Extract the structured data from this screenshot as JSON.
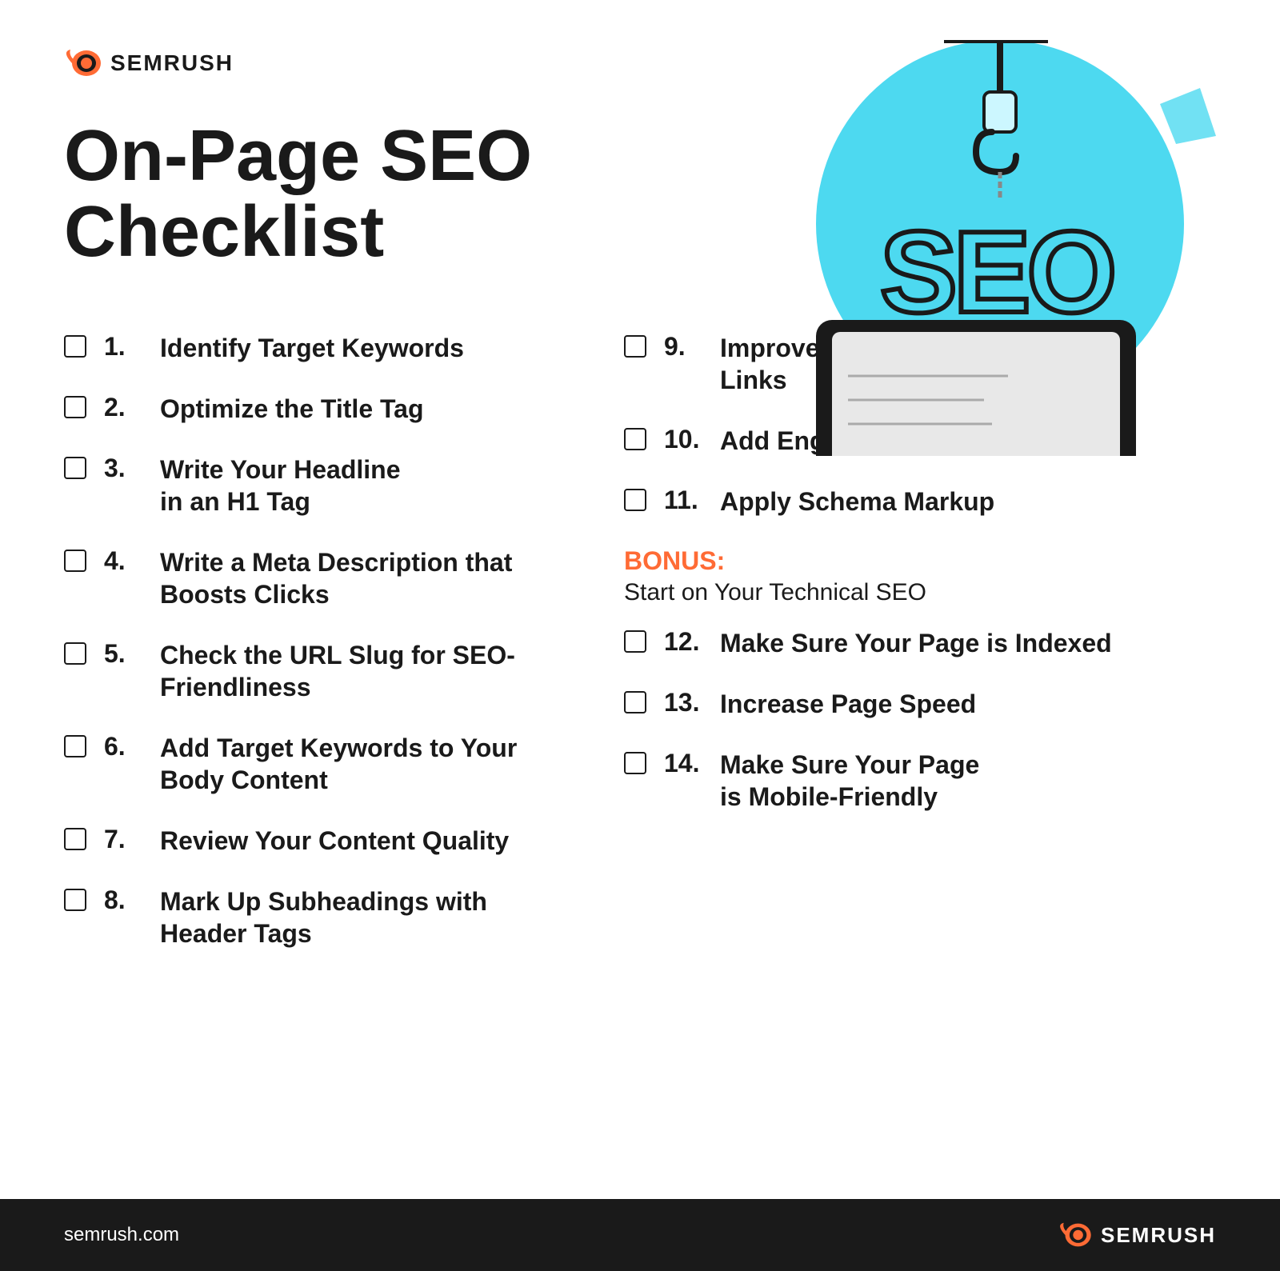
{
  "brand": {
    "name": "SEMRUSH",
    "website": "semrush.com"
  },
  "page": {
    "title_line1": "On-Page SEO",
    "title_line2": "Checklist"
  },
  "checklist_left": [
    {
      "number": "1.",
      "text": "Identify Target Keywords"
    },
    {
      "number": "2.",
      "text": "Optimize the Title Tag"
    },
    {
      "number": "3.",
      "text": "Write Your Headline\nin an H1 Tag"
    },
    {
      "number": "4.",
      "text": "Write a Meta Description that\nBoosts Clicks"
    },
    {
      "number": "5.",
      "text": "Check the URL Slug for SEO-\nFriendliness"
    },
    {
      "number": "6.",
      "text": "Add Target Keywords to Your\nBody Content"
    },
    {
      "number": "7.",
      "text": "Review Your Content Quality"
    },
    {
      "number": "8.",
      "text": "Mark Up Subheadings with\nHeader Tags"
    }
  ],
  "checklist_right": [
    {
      "number": "9.",
      "text": "Improve Navigation with Internal\nLinks"
    },
    {
      "number": "10.",
      "text": "Add Engaging Visual Content"
    },
    {
      "number": "11.",
      "text": "Apply Schema Markup"
    },
    {
      "number": "12.",
      "text": "Make Sure Your Page is Indexed"
    },
    {
      "number": "13.",
      "text": "Increase Page Speed"
    },
    {
      "number": "14.",
      "text": "Make Sure Your Page\nis Mobile-Friendly"
    }
  ],
  "bonus": {
    "label": "BONUS:",
    "subtitle": "Start on Your Technical SEO"
  },
  "colors": {
    "accent": "#ff6b35",
    "dark": "#1a1a1a",
    "cyan": "#4dd9f0",
    "white": "#ffffff"
  }
}
